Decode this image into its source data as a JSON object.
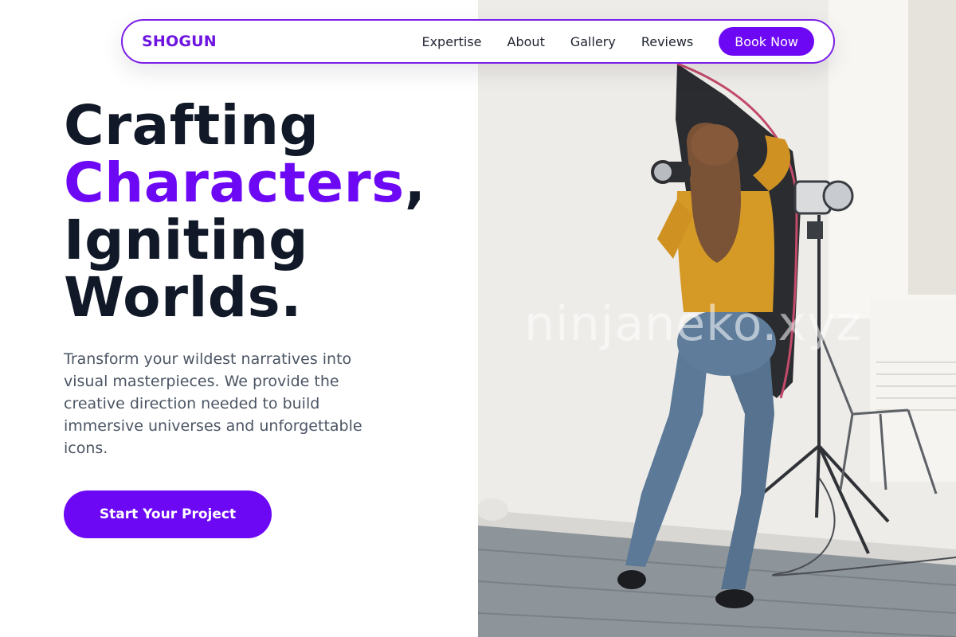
{
  "nav": {
    "brand": "SHOGUN",
    "links": [
      "Expertise",
      "About",
      "Gallery",
      "Reviews"
    ],
    "cta_label": "Book Now"
  },
  "hero": {
    "title_line1": "Crafting",
    "title_accent": "Characters",
    "title_comma": ",",
    "title_line3": "Igniting",
    "title_line4": "Worlds.",
    "subtitle": "Transform your wildest narratives into visual masterpieces. We provide the creative direction needed to build immersive universes and unforgettable icons.",
    "cta_label": "Start Your Project"
  },
  "photo": {
    "watermark": "ninjaneko.xyz",
    "description_icon": "photographer-studio-photo"
  },
  "colors": {
    "accent": "#6d08f5",
    "heading": "#111827",
    "body_text": "#4b5563"
  }
}
